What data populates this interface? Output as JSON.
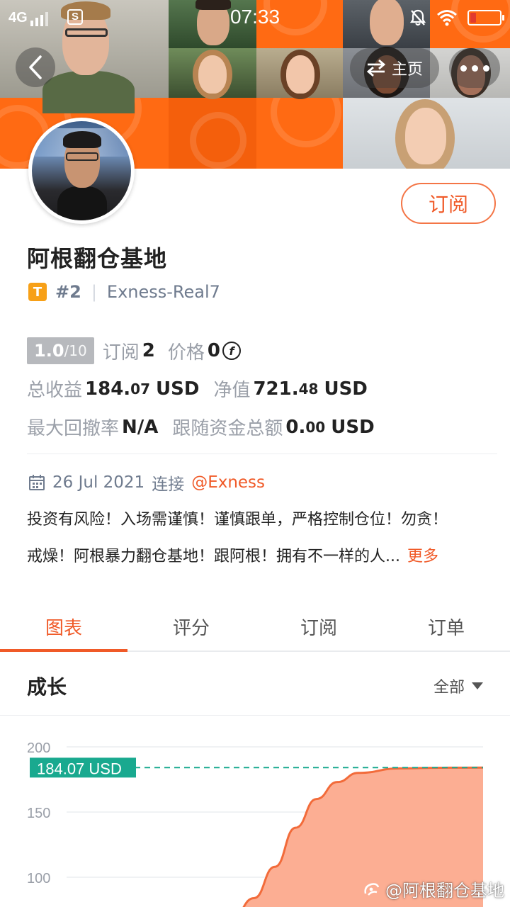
{
  "status_bar": {
    "network": "4G",
    "time": "07:33"
  },
  "nav": {
    "home_label": "主页"
  },
  "profile": {
    "subscribe_label": "订阅",
    "name": "阿根翻仓基地",
    "badge": "T",
    "rank": "#2",
    "account": "Exness-Real7"
  },
  "stats": {
    "score": "1.0",
    "score_max": "/10",
    "subscriptions_label": "订阅",
    "subscriptions_value": "2",
    "price_label": "价格",
    "price_value": "0",
    "total_profit_label": "总收益",
    "total_profit_int": "184.",
    "total_profit_dec": "07",
    "total_profit_unit": "USD",
    "equity_label": "净值",
    "equity_int": "721.",
    "equity_dec": "48",
    "equity_unit": "USD",
    "max_drawdown_label": "最大回撤率",
    "max_drawdown_value": "N/A",
    "follow_funds_label": "跟随资金总额",
    "follow_funds_int": "0.",
    "follow_funds_dec": "00",
    "follow_funds_unit": "USD"
  },
  "connection": {
    "date": "26 Jul 2021",
    "connect_label": "连接",
    "broker": "@Exness"
  },
  "description": {
    "line1": "投资有风险！入场需谨慎！谨慎跟单，严格控制仓位！勿贪！",
    "line2": "戒燥！阿根暴力翻仓基地！跟阿根！拥有不一样的人...",
    "more_label": "更多"
  },
  "tabs": [
    {
      "label": "图表",
      "active": true
    },
    {
      "label": "评分",
      "active": false
    },
    {
      "label": "订阅",
      "active": false
    },
    {
      "label": "订单",
      "active": false
    }
  ],
  "growth": {
    "title": "成长",
    "range_label": "全部"
  },
  "chart_data": {
    "type": "area",
    "title": "",
    "xlabel": "",
    "ylabel": "",
    "yticks": [
      100,
      150,
      200
    ],
    "ylim": [
      70,
      205
    ],
    "current_value_label": "184.07 USD",
    "current_value": 184.07,
    "x": [
      0.0,
      0.4,
      0.45,
      0.5,
      0.55,
      0.6,
      0.65,
      0.7,
      0.8,
      0.9,
      1.0
    ],
    "values": [
      70,
      70,
      84,
      108,
      138,
      160,
      173,
      180,
      183.5,
      184.0,
      184.07
    ],
    "colors": {
      "line": "#f26b3a",
      "fill": "#fcae93",
      "marker": "#19a98f"
    }
  },
  "watermark": {
    "text": "@阿根翻仓基地"
  },
  "colors": {
    "accent": "#f05a28",
    "header_orange": "#ff6a13",
    "muted_text": "#6f7b8e"
  }
}
